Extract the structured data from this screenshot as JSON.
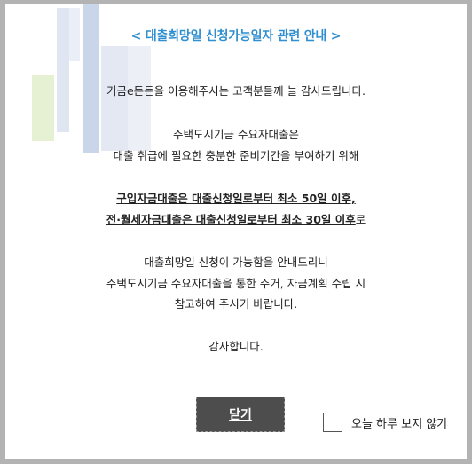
{
  "popup": {
    "title": "< 대출희망일 신청가능일자 관련 안내 >",
    "greeting": "기금e든든을 이용해주시는 고객분들께 늘 감사드립니다.",
    "para1_line1": "주택도시기금 수요자대출은",
    "para1_line2": "대출 취급에 필요한 충분한 준비기간을 부여하기 위해",
    "notice_line1": "구입자금대출은 대출신청일로부터 최소 50일 이후,",
    "notice_line2": "전·월세자금대출은 대출신청일로부터 최소 30일 이후",
    "notice_line2_tail": "로",
    "para2_line1": "대출희망일 신청이 가능함을 안내드리니",
    "para2_line2": "주택도시기금 수요자대출을 통한 주거, 자금계획 수립 시",
    "para2_line3": "참고하여 주시기 바랍니다.",
    "closing": "감사합니다.",
    "close_button": "닫기",
    "dont_show_today": "오늘 하루 보지 않기"
  },
  "colors": {
    "title": "#2f8fd0",
    "frame_border": "#b3b3b3",
    "close_button_bg": "#4d4d4d",
    "deco_blue_1": "#c9d6ea",
    "deco_blue_2": "#dfe6f2",
    "deco_green": "#e6f0d2"
  }
}
